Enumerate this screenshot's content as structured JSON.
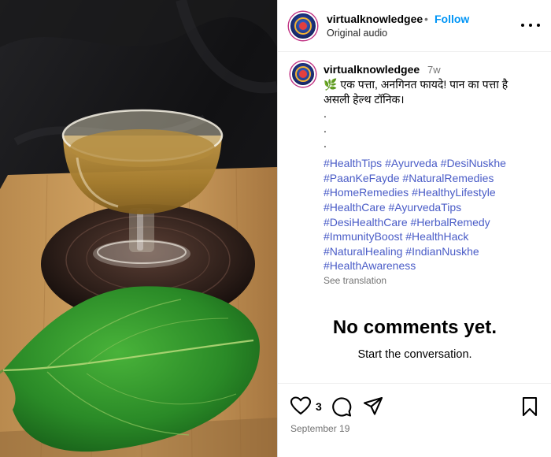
{
  "post": {
    "username": "virtualknowledgee",
    "separator": "•",
    "follow_label": "Follow",
    "audio": "Original audio",
    "more_icon": "more-horizontal-icon"
  },
  "caption": {
    "username": "virtualknowledgee",
    "time": "7w",
    "lines": [
      "🌿 एक पत्ता, अनगिनत फायदे! पान का पत्ता है",
      "असली हेल्थ टॉनिक।"
    ],
    "dots": [
      ".",
      ".",
      "."
    ],
    "hashtag_lines": [
      [
        "#HealthTips",
        "#Ayurveda",
        "#DesiNuskhe"
      ],
      [
        "#PaanKeFayde",
        "#NaturalRemedies"
      ],
      [
        "#HomeRemedies",
        "#HealthyLifestyle"
      ],
      [
        "#HealthCare",
        "#AyurvedaTips"
      ],
      [
        "#DesiHealthCare",
        "#HerbalRemedy"
      ],
      [
        "#ImmunityBoost",
        "#HealthHack"
      ],
      [
        "#NaturalHealing",
        "#IndianNuskhe"
      ],
      [
        "#HealthAwareness"
      ]
    ],
    "see_translation": "See translation"
  },
  "comments": {
    "empty_title": "No comments yet.",
    "empty_subtitle": "Start the conversation."
  },
  "actions": {
    "like_count": "3",
    "date": "September 19",
    "icons": [
      "heart-icon",
      "comment-icon",
      "share-icon",
      "bookmark-icon"
    ]
  },
  "colors": {
    "follow": "#0095f6",
    "hashtag": "#4a5cc7",
    "muted": "#737373",
    "divider": "#dbdbdb"
  }
}
